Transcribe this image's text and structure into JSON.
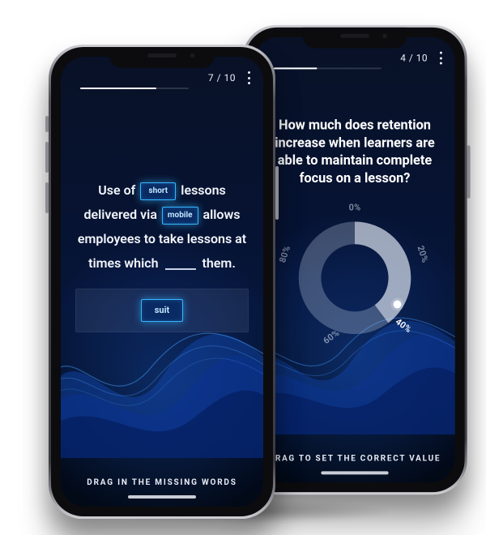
{
  "left": {
    "progress": {
      "current": 7,
      "total": 10,
      "label": "7 / 10"
    },
    "sentence": {
      "prefix": "Use of ",
      "slot1": "short",
      "mid1": " lessons delivered via ",
      "slot2": "mobile",
      "mid2": " allows employees to take lessons at times which ",
      "suffix": " them."
    },
    "tray_chip": "suit",
    "footer": "DRAG IN THE MISSING WORDS"
  },
  "right": {
    "progress": {
      "current": 4,
      "total": 10,
      "label": "4 / 10"
    },
    "question": "How much does retention increase when learners are able to maintain complete focus on a lesson?",
    "dial": {
      "ticks": {
        "t0": "0%",
        "t20": "20%",
        "t40": "40%",
        "t60": "60%",
        "t80": "80%"
      },
      "value_label": "40%",
      "value_pct": 40
    },
    "footer": "DRAG TO SET THE CORRECT VALUE"
  },
  "colors": {
    "accent": "#2aa9ff",
    "chip_border": "#35b6ff"
  }
}
